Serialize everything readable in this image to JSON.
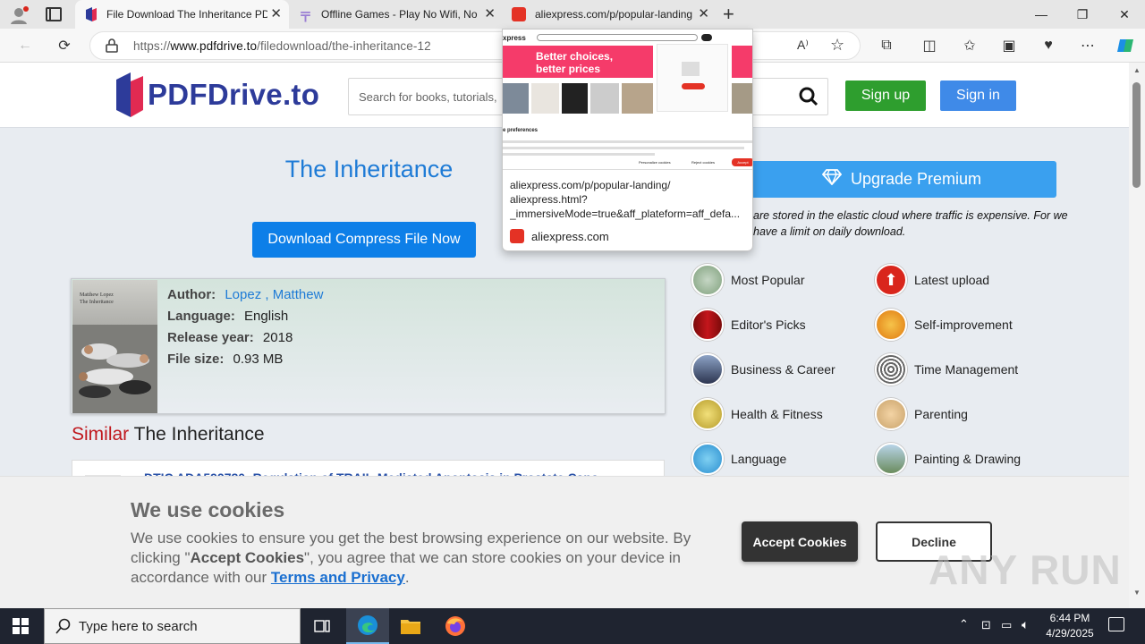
{
  "browser": {
    "tabs": [
      {
        "title": "File Download The Inheritance PDF",
        "active": true
      },
      {
        "title": "Offline Games - Play No Wifi, No",
        "active": false
      },
      {
        "title": "aliexpress.com/p/popular-landing",
        "active": false
      }
    ],
    "new_tab": "+",
    "window_controls": {
      "minimize": "—",
      "restore": "❐",
      "close": "✕"
    },
    "url_prefix": "https://",
    "url_domain": "www.pdfdrive.to",
    "url_path": "/filedownload/the-inheritance-12"
  },
  "popup": {
    "url_line1": "aliexpress.com/p/popular-landing/",
    "url_line2": "aliexpress.html?",
    "url_line3": "_immersiveMode=true&aff_plateform=aff_defa...",
    "domain": "aliexpress.com",
    "banner_text1": "Better choices,",
    "banner_text2": "better prices",
    "brand": "xpress",
    "prefs_title": "e preferences",
    "btn_personalize": "Personalize cookies",
    "btn_reject": "Reject cookies",
    "btn_accept": "Accept"
  },
  "site": {
    "logo": "PDFDrive.to",
    "search_placeholder": "Search for books, tutorials,",
    "signup": "Sign up",
    "signin": "Sign in",
    "book_title": "The Inheritance",
    "download_button": "Download Compress File Now",
    "cover_author": "Matthew Lopez",
    "cover_title": "The Inheritance",
    "meta": {
      "author_label": "Author:",
      "author_first": "Lopez",
      "author_second": ", Matthew",
      "language_label": "Language:",
      "language": "English",
      "year_label": "Release year:",
      "year": "2018",
      "size_label": "File size:",
      "size": "0.93 MB"
    },
    "similar_red": "Similar",
    "similar_rest": "The Inheritance",
    "similar_item": "DTIC ADA592780: Regulation of TRAIL-Mediated Apoptosis in Prostate Canc",
    "premium": "Upgrade Premium",
    "premium_note": "are stored in the elastic cloud where traffic is expensive. For we have a limit on daily download.",
    "categories": [
      {
        "label": "Most Popular",
        "icon": "popular-icon"
      },
      {
        "label": "Latest upload",
        "icon": "upload-arrow-icon"
      },
      {
        "label": "Editor's Picks",
        "icon": "curtain-icon"
      },
      {
        "label": "Self-improvement",
        "icon": "runner-icon"
      },
      {
        "label": "Business & Career",
        "icon": "business-icon"
      },
      {
        "label": "Time Management",
        "icon": "spiral-clock-icon"
      },
      {
        "label": "Health & Fitness",
        "icon": "health-icon"
      },
      {
        "label": "Parenting",
        "icon": "child-icon"
      },
      {
        "label": "Language",
        "icon": "speech-bubble-icon"
      },
      {
        "label": "Painting & Drawing",
        "icon": "landscape-icon"
      }
    ]
  },
  "cookie": {
    "title": "We use cookies",
    "text_a": "We use cookies to ensure you get the best browsing experience on our website. By clicking \"",
    "text_b": "Accept Cookies",
    "text_c": "\", you agree that we can store cookies on your device in accordance with our ",
    "link": "Terms and Privacy",
    "text_d": ".",
    "accept": "Accept Cookies",
    "decline": "Decline"
  },
  "watermark": "ANY RUN",
  "taskbar": {
    "search_placeholder": "Type here to search",
    "time": "6:44 PM",
    "date": "4/29/2025"
  },
  "colors": {
    "accent_blue": "#1e7bd6",
    "signup_green": "#2e9e2e",
    "signin_blue": "#3f8ae8",
    "similar_red": "#c0181e"
  }
}
